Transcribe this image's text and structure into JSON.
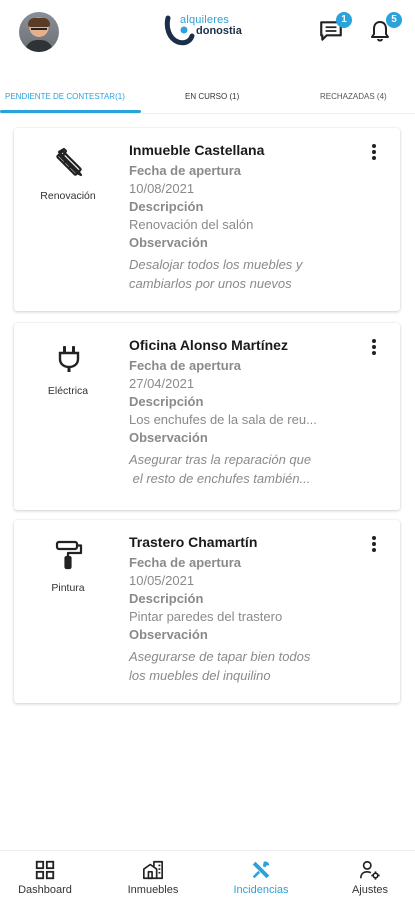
{
  "header": {
    "logo_line1": "alquileres",
    "logo_line2": "donostia",
    "messages_badge": "1",
    "notifications_badge": "5"
  },
  "tabs": [
    {
      "label": "PENDIENTE DE CONTESTAR(1)",
      "active": true
    },
    {
      "label": "EN CURSO (1)",
      "active": false
    },
    {
      "label": "RECHAZADAS (4)",
      "active": false
    }
  ],
  "labels": {
    "fecha": "Fecha de apertura",
    "descripcion": "Descripción",
    "observacion": "Observación"
  },
  "cards": [
    {
      "category": "Renovación",
      "icon": "tools-icon",
      "title": "Inmueble Castellana",
      "fecha": "10/08/2021",
      "descripcion": "Renovación del salón",
      "obs_line1": "Desalojar todos los muebles y",
      "obs_line2": "cambiarlos por unos nuevos"
    },
    {
      "category": "Eléctrica",
      "icon": "plug-icon",
      "title": "Oficina Alonso Martínez",
      "fecha": "27/04/2021",
      "descripcion": "Los enchufes de la sala de reu...",
      "obs_line1": "Asegurar tras la reparación que",
      "obs_line2": " el resto de enchufes también..."
    },
    {
      "category": "Pintura",
      "icon": "paint-roller-icon",
      "title": "Trastero Chamartín",
      "fecha": "10/05/2021",
      "descripcion": "Pintar paredes del trastero",
      "obs_line1": "Asegurarse de tapar bien todos",
      "obs_line2": "los muebles del inquilino"
    }
  ],
  "nav": [
    {
      "label": "Dashboard",
      "icon": "dashboard-icon",
      "active": false
    },
    {
      "label": "Inmuebles",
      "icon": "buildings-icon",
      "active": false
    },
    {
      "label": "Incidencias",
      "icon": "tools-icon",
      "active": true
    },
    {
      "label": "Ajustes",
      "icon": "user-settings-icon",
      "active": false
    }
  ],
  "colors": {
    "accent": "#2aa3dc",
    "navy": "#1c2e4a",
    "muted_text": "#8a8a8a"
  }
}
